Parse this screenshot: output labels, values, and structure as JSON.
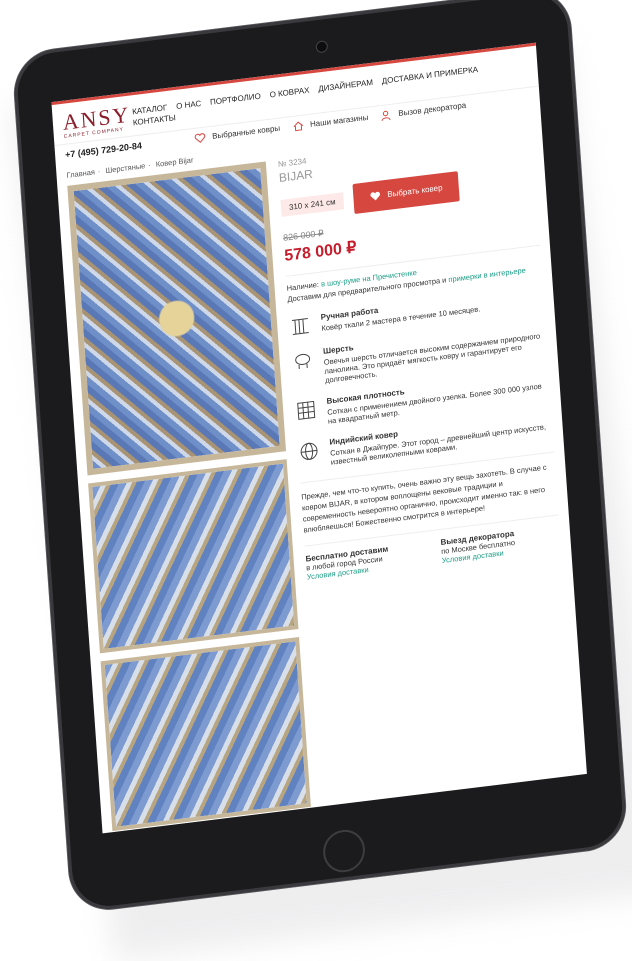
{
  "header": {
    "logo": "ANSY",
    "logo_sub": "CARPET COMPANY",
    "nav": [
      "Каталог",
      "О нас",
      "Портфолио",
      "О коврах",
      "Дизайнерам",
      "Доставка и примерка",
      "Контакты"
    ],
    "phone": "+7 (495) 729-20-84",
    "favorites": "Выбранные ковры",
    "stores": "Наши магазины",
    "decorator": "Вызов декоратора"
  },
  "breadcrumb": [
    "Главная",
    "Шерстяные",
    "Ковер Bijar"
  ],
  "product": {
    "article": "№ 3234",
    "name": "BIJAR",
    "size": "310 x 241 см",
    "select_button": "Выбрать ковер",
    "old_price": "826 000 ₽",
    "price": "578 000 ₽",
    "availability_prefix": "Наличие:",
    "availability_link": "в шоу-руме на Пречистенке",
    "availability_text": "Доставим для предварительного просмотра и",
    "fitting_link": "примерки в интерьере"
  },
  "features": [
    {
      "icon": "loom-icon",
      "title": "Ручная работа",
      "text": "Ковёр ткали 2 мастера в течение 10 месяцев."
    },
    {
      "icon": "sheep-icon",
      "title": "Шерсть",
      "text": "Овечья шерсть отличается высоким содержанием природного ланолина. Это придаёт мягкость ковру и гарантирует его долговечность."
    },
    {
      "icon": "grid-icon",
      "title": "Высокая плотность",
      "text": "Соткан с применением двойного узелка. Более 300 000 узлов на квадратный метр."
    },
    {
      "icon": "globe-icon",
      "title": "Индийский ковер",
      "text": "Соткан в Джайпуре. Этот город – древнейший центр искусств, известный великолепными коврами."
    }
  ],
  "description": "Прежде, чем что-то купить, очень важно эту вещь захотеть. В случае с ковром BIJAR, в котором воплощены вековые традиции и современность невероятно органично, происходит именно так: в него влюбляешься! Божественно смотрится в интерьере!",
  "delivery": {
    "free_title": "Бесплатно доставим",
    "free_text": "в любой город России",
    "free_link": "Условия доставки",
    "decor_title": "Выезд декоратора",
    "decor_text": "по Москве бесплатно",
    "decor_link": "Условия доставки"
  },
  "colors": {
    "accent": "#d5473f",
    "brand": "#8a1e2a",
    "link": "#1b9d86",
    "price": "#c51d2c"
  }
}
